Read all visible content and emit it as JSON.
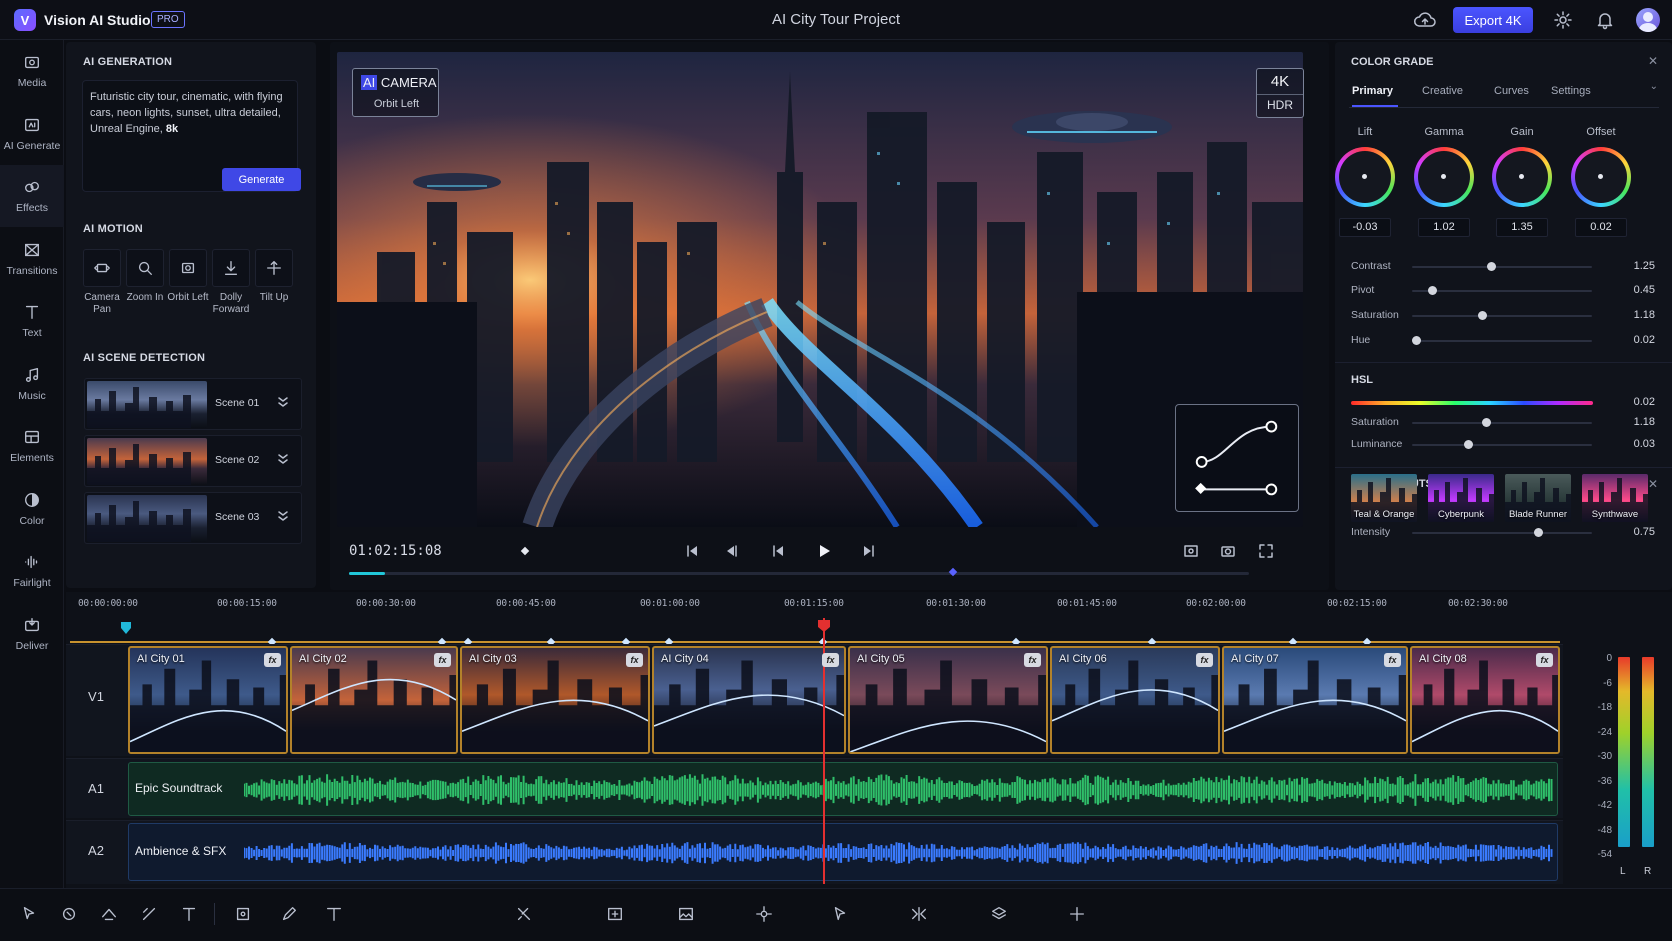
{
  "app": {
    "name": "Vision AI Studio",
    "badge": "PRO",
    "project_title": "AI City Tour Project",
    "export_label": "Export 4K",
    "accent": "#4b55ff"
  },
  "rail": [
    {
      "label": "Media",
      "icon": "media-icon"
    },
    {
      "label": "AI Generate",
      "icon": "ai-generate-icon"
    },
    {
      "label": "Effects",
      "icon": "effects-icon"
    },
    {
      "label": "Transitions",
      "icon": "transitions-icon"
    },
    {
      "label": "Text",
      "icon": "text-icon"
    },
    {
      "label": "Music",
      "icon": "music-icon"
    },
    {
      "label": "Elements",
      "icon": "elements-icon"
    },
    {
      "label": "Color",
      "icon": "color-icon"
    },
    {
      "label": "Fairlight",
      "icon": "fairlight-icon"
    },
    {
      "label": "Deliver",
      "icon": "deliver-icon"
    }
  ],
  "ai_generation": {
    "title": "AI GENERATION",
    "prompt": "Futuristic city tour, cinematic, with flying cars, neon lights, sunset, ultra detailed, Unreal Engine, ",
    "prompt_bold": "8k",
    "generate_label": "Generate"
  },
  "ai_motion": {
    "title": "AI MOTION",
    "items": [
      {
        "label": "Camera Pan",
        "icon": "camera-pan-icon"
      },
      {
        "label": "Zoom In",
        "icon": "zoom-in-icon"
      },
      {
        "label": "Orbit Left",
        "icon": "orbit-left-icon"
      },
      {
        "label": "Dolly Forward",
        "icon": "dolly-forward-icon"
      },
      {
        "label": "Tilt Up",
        "icon": "tilt-up-icon"
      }
    ]
  },
  "scene_detection": {
    "title": "AI SCENE DETECTION",
    "scenes": [
      "Scene 01",
      "Scene 02",
      "Scene 03"
    ]
  },
  "viewer": {
    "camera_title_ai": "AI",
    "camera_title": " CAMERA",
    "camera_mode": "Orbit Left",
    "resolution": "4K",
    "hdr": "HDR",
    "timecode": "01:02:15:08",
    "progress": 0.04
  },
  "color_grade": {
    "title": "COLOR GRADE",
    "tabs": [
      "Primary",
      "Creative",
      "Curves",
      "Settings"
    ],
    "active_tab": "Primary",
    "wheels": [
      {
        "label": "Lift",
        "value": "-0.03"
      },
      {
        "label": "Gamma",
        "value": "1.02"
      },
      {
        "label": "Gain",
        "value": "1.35"
      },
      {
        "label": "Offset",
        "value": "0.02"
      }
    ],
    "sliders": [
      {
        "label": "Contrast",
        "value": "1.25",
        "pos": 0.44
      },
      {
        "label": "Pivot",
        "value": "0.45",
        "pos": 0.11
      },
      {
        "label": "Saturation",
        "value": "1.18",
        "pos": 0.39
      },
      {
        "label": "Hue",
        "value": "0.02",
        "pos": 0.02
      }
    ]
  },
  "hsl": {
    "title": "HSL",
    "hue_value": "0.02",
    "sliders": [
      {
        "label": "Saturation",
        "value": "1.18",
        "pos": 0.41
      },
      {
        "label": "Luminance",
        "value": "0.03",
        "pos": 0.31
      }
    ]
  },
  "looks": {
    "title": "LOOKS & LUTS",
    "items": [
      "Teal & Orange",
      "Cyberpunk",
      "Blade Runner",
      "Synthwave"
    ],
    "intensity_label": "Intensity",
    "intensity_value": "0.75",
    "intensity_pos": 0.7
  },
  "timeline": {
    "ruler": [
      "00:00:00:00",
      "00:00:15:00",
      "00:00:30:00",
      "00:00:45:00",
      "00:01:00:00",
      "00:01:15:00",
      "00:01:30:00",
      "00:01:45:00",
      "00:02:00:00",
      "00:02:15:00",
      "00:02:30:00"
    ],
    "tracks": {
      "v1": "V1",
      "a1": "A1",
      "a2": "A2"
    },
    "clips": [
      "AI City 01",
      "AI City 02",
      "AI City 03",
      "AI City 04",
      "AI City 05",
      "AI City 06",
      "AI City 07",
      "AI City 08"
    ],
    "fx_label": "fx",
    "audio": {
      "a1": "Epic Soundtrack",
      "a2": "Ambience & SFX"
    },
    "meter_db": [
      "0",
      "-6",
      "-18",
      "-24",
      "-30",
      "-36",
      "-42",
      "-48",
      "-54"
    ],
    "meter_channels": [
      "L",
      "R"
    ]
  }
}
